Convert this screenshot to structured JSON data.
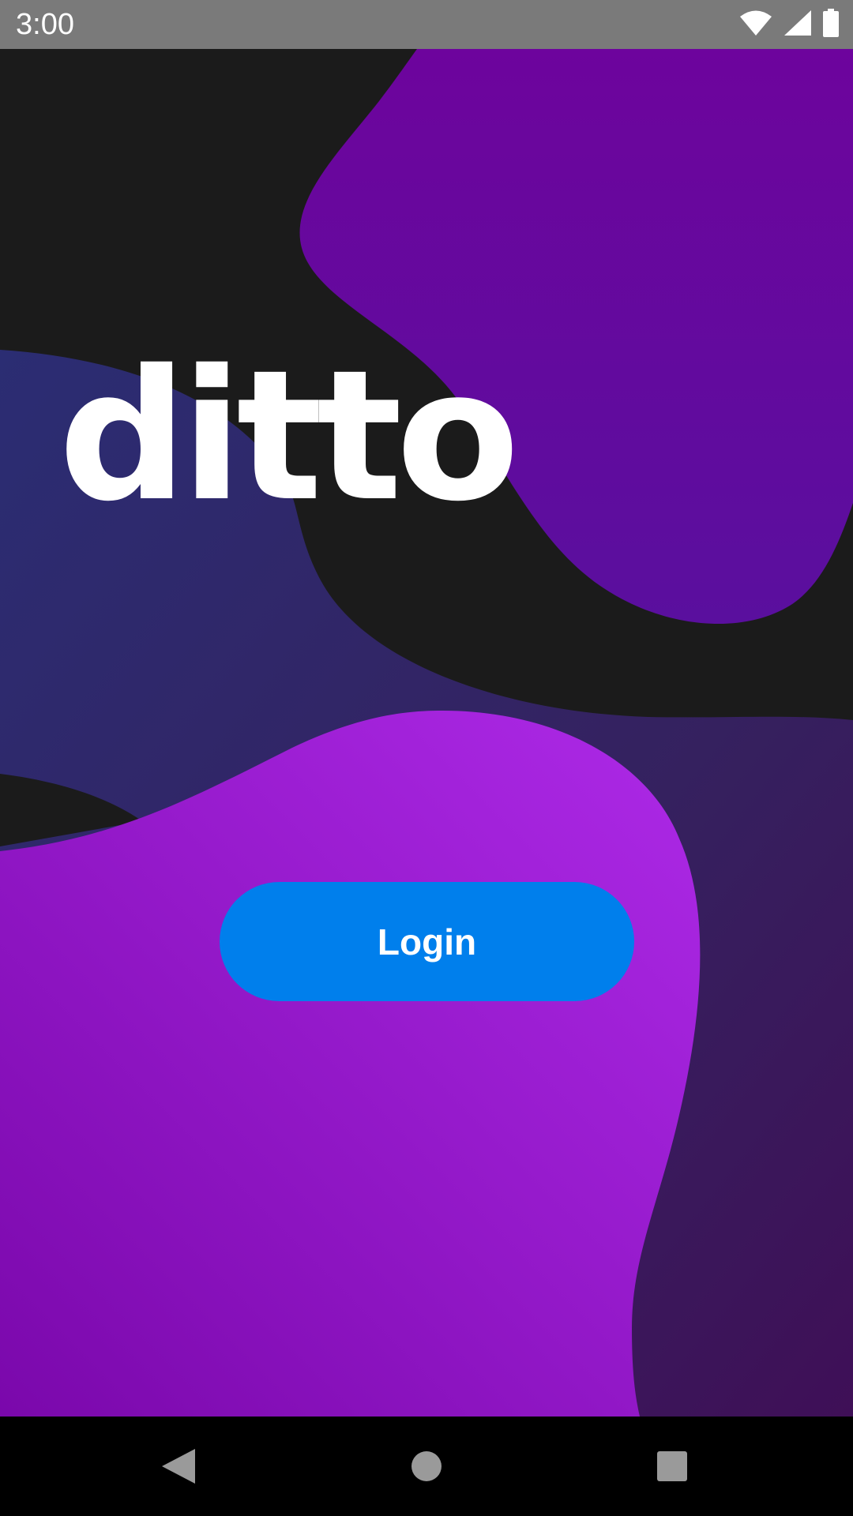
{
  "status_bar": {
    "time": "3:00",
    "icons": [
      "wifi-icon",
      "cell-signal-icon",
      "battery-icon"
    ]
  },
  "app": {
    "logo_text": "ditto",
    "login_label": "Login"
  },
  "nav_bar": {
    "buttons": [
      "back-icon",
      "home-icon",
      "recents-icon"
    ]
  },
  "colors": {
    "background": "#1b1b1b",
    "accent_button": "#007fec",
    "blob_purple": "#6a069f",
    "blob_magenta": "#a62be4",
    "blob_indigo": "#2e2b70",
    "status_bar": "#7a7a7a"
  }
}
